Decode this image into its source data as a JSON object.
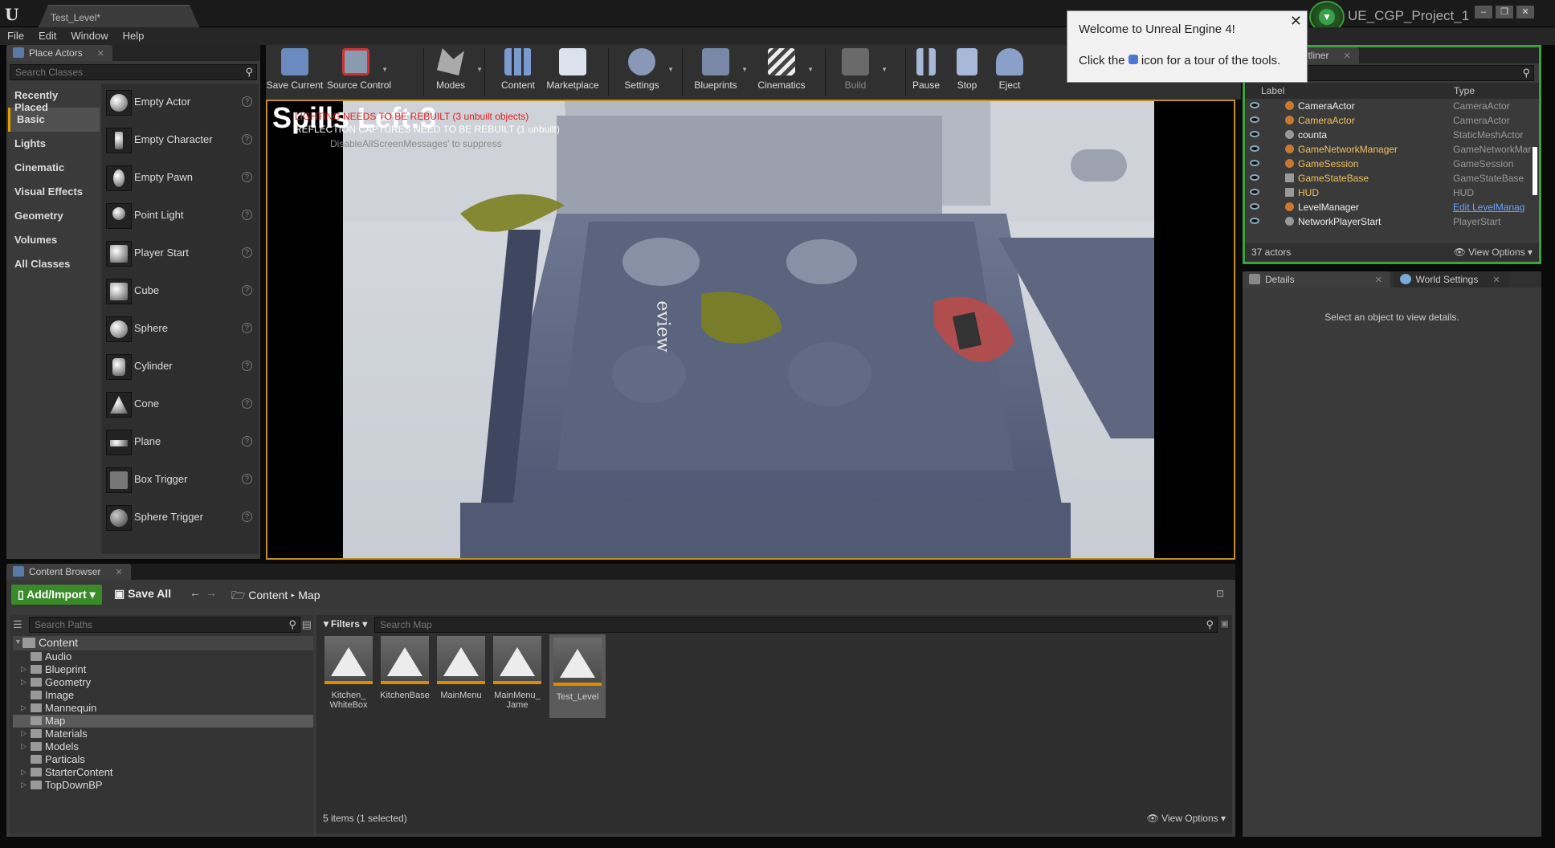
{
  "window": {
    "doc_tab": "Test_Level*",
    "project_name": "UE_CGP_Project_1"
  },
  "menu": [
    "File",
    "Edit",
    "Window",
    "Help"
  ],
  "place_actors": {
    "tab": "Place Actors",
    "search_placeholder": "Search Classes",
    "categories": [
      "Recently Placed",
      "Basic",
      "Lights",
      "Cinematic",
      "Visual Effects",
      "Geometry",
      "Volumes",
      "All Classes"
    ],
    "selected_category": "Basic",
    "items": [
      "Empty Actor",
      "Empty Character",
      "Empty Pawn",
      "Point Light",
      "Player Start",
      "Cube",
      "Sphere",
      "Cylinder",
      "Cone",
      "Plane",
      "Box Trigger",
      "Sphere Trigger"
    ]
  },
  "toolbar": {
    "buttons": [
      "Save Current",
      "Source Control",
      "Modes",
      "Content",
      "Marketplace",
      "Settings",
      "Blueprints",
      "Cinematics",
      "Build",
      "Pause",
      "Stop",
      "Eject"
    ]
  },
  "viewport": {
    "spills_label": "Spills Left:",
    "spills_value": "3",
    "msg_lighting": "LIGHTING NEEDS TO BE REBUILT (3 unbuilt objects)",
    "msg_reflection": "REFLECTION CAPTURES NEED TO BE REBUILT (1 unbuilt)",
    "msg_suppress": "DisableAllScreenMessages' to suppress",
    "preview_text": "eview"
  },
  "popup": {
    "title": "Welcome to Unreal Engine 4!",
    "line_before": "Click the",
    "line_after": "icon for a tour of the tools."
  },
  "outliner": {
    "tab": "World Outliner",
    "col_label": "Label",
    "col_type": "Type",
    "rows": [
      {
        "label": "CameraActor",
        "type": "CameraActor"
      },
      {
        "label": "CameraActor",
        "type": "CameraActor"
      },
      {
        "label": "counta",
        "type": "StaticMeshActor"
      },
      {
        "label": "GameNetworkManager",
        "type": "GameNetworkMar"
      },
      {
        "label": "GameSession",
        "type": "GameSession"
      },
      {
        "label": "GameStateBase",
        "type": "GameStateBase"
      },
      {
        "label": "HUD",
        "type": "HUD"
      },
      {
        "label": "LevelManager",
        "type": "Edit LevelManag"
      },
      {
        "label": "NetworkPlayerStart",
        "type": "PlayerStart"
      }
    ],
    "count": "37 actors",
    "view_options": "View Options"
  },
  "details": {
    "tab_details": "Details",
    "tab_world_settings": "World Settings",
    "empty_msg": "Select an object to view details."
  },
  "content_browser": {
    "tab": "Content Browser",
    "add_import": "Add/Import",
    "save_all": "Save All",
    "crumb_root": "Content",
    "crumb_leaf": "Map",
    "search_paths": "Search Paths",
    "filters": "Filters",
    "search_map": "Search Map",
    "tree_root": "Content",
    "tree": [
      "Audio",
      "Blueprint",
      "Geometry",
      "Image",
      "Mannequin",
      "Map",
      "Materials",
      "Models",
      "Particals",
      "StarterContent",
      "TopDownBP"
    ],
    "tree_selected": "Map",
    "assets": [
      "Kitchen_ WhiteBox",
      "KitchenBase",
      "MainMenu",
      "MainMenu_ Jame",
      "Test_Level"
    ],
    "status": "5 items (1 selected)",
    "view_options": "View Options"
  }
}
